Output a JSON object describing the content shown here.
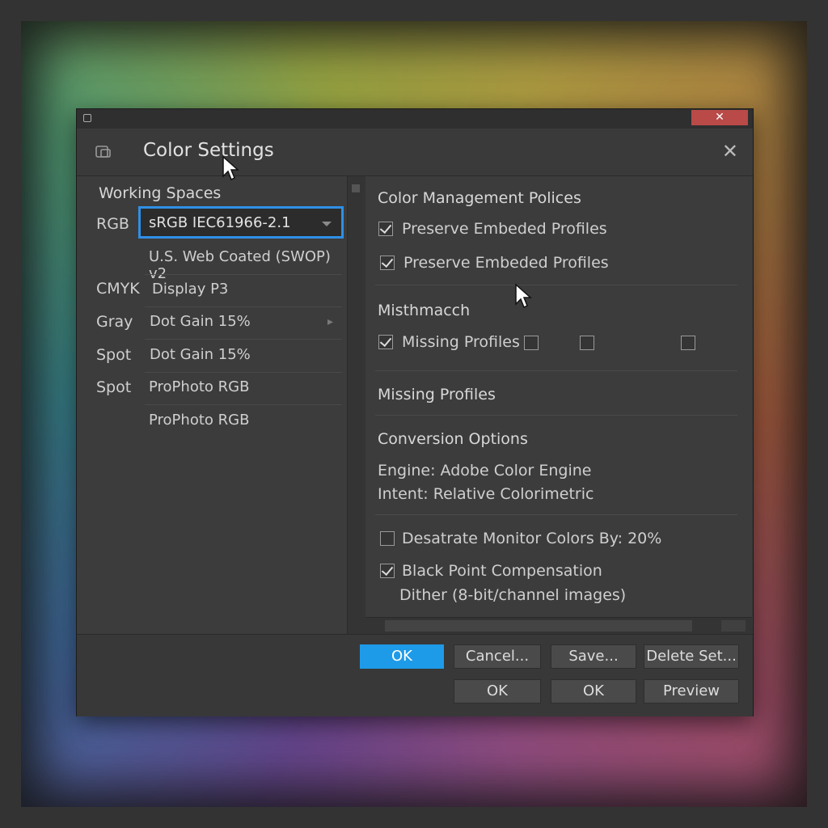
{
  "dialog": {
    "title": "Color Settings",
    "os_close_glyph": "✕",
    "title_close_glyph": "✕"
  },
  "working_spaces": {
    "heading": "Working Spaces",
    "rows": [
      {
        "label": "RGB",
        "value": "sRGB IEC61966-2.1",
        "selected": true
      },
      {
        "label": "",
        "value": "U.S. Web Coated (SWOP) v2"
      },
      {
        "label": "CMYK",
        "value": "Display P3"
      },
      {
        "label": "Gray",
        "value": "Dot Gain 15%",
        "arrow": "▸"
      },
      {
        "label": "Spot",
        "value": "Dot Gain 15%"
      },
      {
        "label": "Spot",
        "value": "ProPhoto RGB"
      },
      {
        "label": "",
        "value": "ProPhoto RGB"
      }
    ]
  },
  "policies": {
    "heading": "Color Management Polices",
    "items": [
      {
        "label": "Preserve Embeded Profiles",
        "checked": true
      },
      {
        "label": "Preserve Embeded Profiles",
        "checked": true
      }
    ]
  },
  "mismatch": {
    "heading": "Misthmacch",
    "missing_label": "Missing Profiles",
    "missing_checked": true
  },
  "missing_profiles": {
    "heading": "Missing Profiles"
  },
  "conversion": {
    "heading": "Conversion Options",
    "engine": "Engine: Adobe Color Engine",
    "intent": "Intent: Relative Colorimetric"
  },
  "advanced": {
    "desaturate": {
      "label": "Desatrate Monitor Colors By: 20%",
      "checked": false
    },
    "black_point": {
      "label": "Black Point Compensation",
      "checked": true
    },
    "dither": "Dither (8-bit/channel images)"
  },
  "buttons": {
    "ok_primary": "OK",
    "cancel": "Cancel...",
    "save": "Save...",
    "delete_set": "Delete Set...",
    "ok_2": "OK",
    "ok_3": "OK",
    "preview": "Preview"
  },
  "colors": {
    "accent": "#1e9be8",
    "focus_border": "#2f8fe6",
    "os_close": "#b94a48",
    "panel": "#3c3c3c"
  },
  "icons": {
    "title_icon": "color-settings-icon",
    "cursor": "mouse-cursor-icon"
  }
}
